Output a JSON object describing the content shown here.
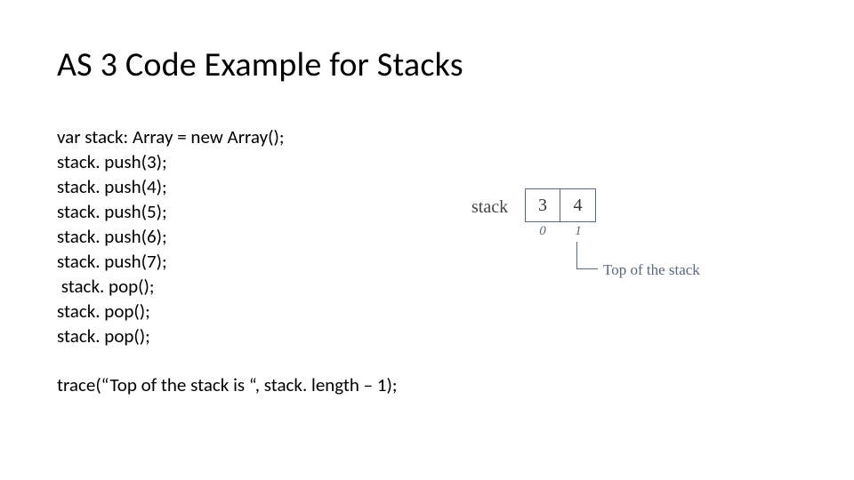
{
  "title": "AS 3 Code Example for Stacks",
  "code": {
    "l1": "var stack: Array = new Array();",
    "l2": "stack. push(3);",
    "l3": "stack. push(4);",
    "l4": "stack. push(5);",
    "l5": "stack. push(6);",
    "l6": "stack. push(7);",
    "l7": " stack. pop();",
    "l8": "stack. pop();",
    "l9": "stack. pop();"
  },
  "trace": "trace(“Top of the stack is “, stack. length – 1);",
  "diagram": {
    "label": "stack",
    "cells": [
      "3",
      "4"
    ],
    "indices": [
      "0",
      "1"
    ],
    "caption": "Top of the stack"
  }
}
